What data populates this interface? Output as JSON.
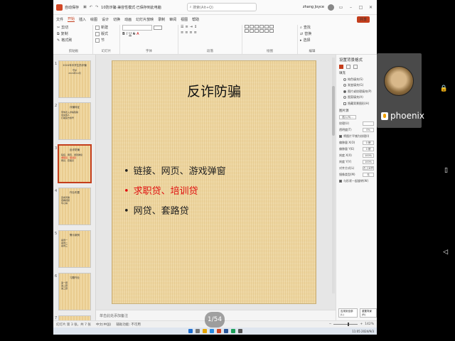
{
  "titlebar": {
    "autosave": "自动保存",
    "filename": "10防诈骗·兼容性模式·已保存到此电脑",
    "search_placeholder": "搜索(Alt+Q)",
    "user_name": "zhang Joyce"
  },
  "menu": {
    "items": [
      "文件",
      "开始",
      "插入",
      "绘图",
      "设计",
      "切换",
      "动画",
      "幻灯片放映",
      "录制",
      "审阅",
      "视图",
      "帮助"
    ],
    "active": "开始",
    "share": "共享"
  },
  "ribbon": {
    "groups": [
      "剪贴板",
      "幻灯片",
      "字体",
      "段落",
      "绘图",
      "编辑"
    ],
    "clipboard_tools": [
      "剪切",
      "复制",
      "格式刷"
    ],
    "slides_tools": [
      "新建",
      "版式",
      "节"
    ],
    "editing_tools": [
      "查找",
      "替换",
      "选择"
    ]
  },
  "thumbnails": [
    {
      "num": "1",
      "title": "2024年中学生防诈骗",
      "lines": [
        "守护",
        "2024年10月"
      ]
    },
    {
      "num": "2",
      "title": "诈骗特征",
      "lines": [
        "带你走入诈骗陷阱",
        "冒充熟人",
        "打着官方旗号"
      ]
    },
    {
      "num": "3",
      "title": "反诈防骗",
      "lines": [
        "链接、网页、游戏弹窗",
        "求职贷、培训贷",
        "网贷、套路贷"
      ]
    },
    {
      "num": "4",
      "title": "作业布置",
      "lines": [
        "完成问卷",
        "观看视频",
        "写心得"
      ]
    },
    {
      "num": "5",
      "title": "警示案例",
      "lines": [
        "案例一",
        "案例二",
        "案例三"
      ]
    },
    {
      "num": "6",
      "title": "习题作业",
      "lines": [
        "第一题",
        "第二题",
        "第三题"
      ]
    },
    {
      "num": "7",
      "title": "",
      "lines": []
    }
  ],
  "slide": {
    "title": "反诈防骗",
    "bullets": [
      {
        "text": "链接、网页、游戏弹窗",
        "color": "#222222"
      },
      {
        "text": "求职贷、培训贷",
        "color": "#e01010"
      },
      {
        "text": "网贷、套路贷",
        "color": "#222222"
      }
    ]
  },
  "notes_placeholder": "单击此处添加备注",
  "format_pane": {
    "title": "设置背景格式",
    "section_fill": "填充",
    "fill_options": [
      "纯色填充(S)",
      "渐变填充(G)",
      "图片或纹理填充(P)",
      "图案填充(A)",
      "隐藏背景图形(H)"
    ],
    "selected_fill": "图片或纹理填充(P)",
    "source_label": "图片源",
    "insert_button": "插入(R)...",
    "texture_label": "纹理(U)",
    "transparency_label": "透明度(T)",
    "transparency_value": "0%",
    "tile_checkbox": "将图片平铺为纹理(I)",
    "offset_x_label": "偏移量 X(O)",
    "offset_x_value": "0 磅",
    "offset_y_label": "偏移量 Y(E)",
    "offset_y_value": "0 磅",
    "scale_x_label": "刻度 X(X)",
    "scale_x_value": "100%",
    "scale_y_label": "刻度 Y(Y)",
    "scale_y_value": "100%",
    "align_label": "对齐方式(L)",
    "align_value": "左上对齐",
    "mirror_label": "镜像类型(M)",
    "mirror_value": "无",
    "rotate_checkbox": "与形状一起旋转(W)",
    "apply_all_button": "应用到全部(L)",
    "reset_button": "重置背景(B)"
  },
  "statusbar": {
    "slide_info": "幻灯片 第 3 张，共 7 张",
    "language": "中文(中国)",
    "accessibility": "辅助功能: 不可用",
    "zoom": "142%"
  },
  "taskbar": {
    "time": "11:05",
    "date": "2024/9/3"
  },
  "page_indicator": "1/54",
  "video": {
    "name": "phoenix"
  }
}
